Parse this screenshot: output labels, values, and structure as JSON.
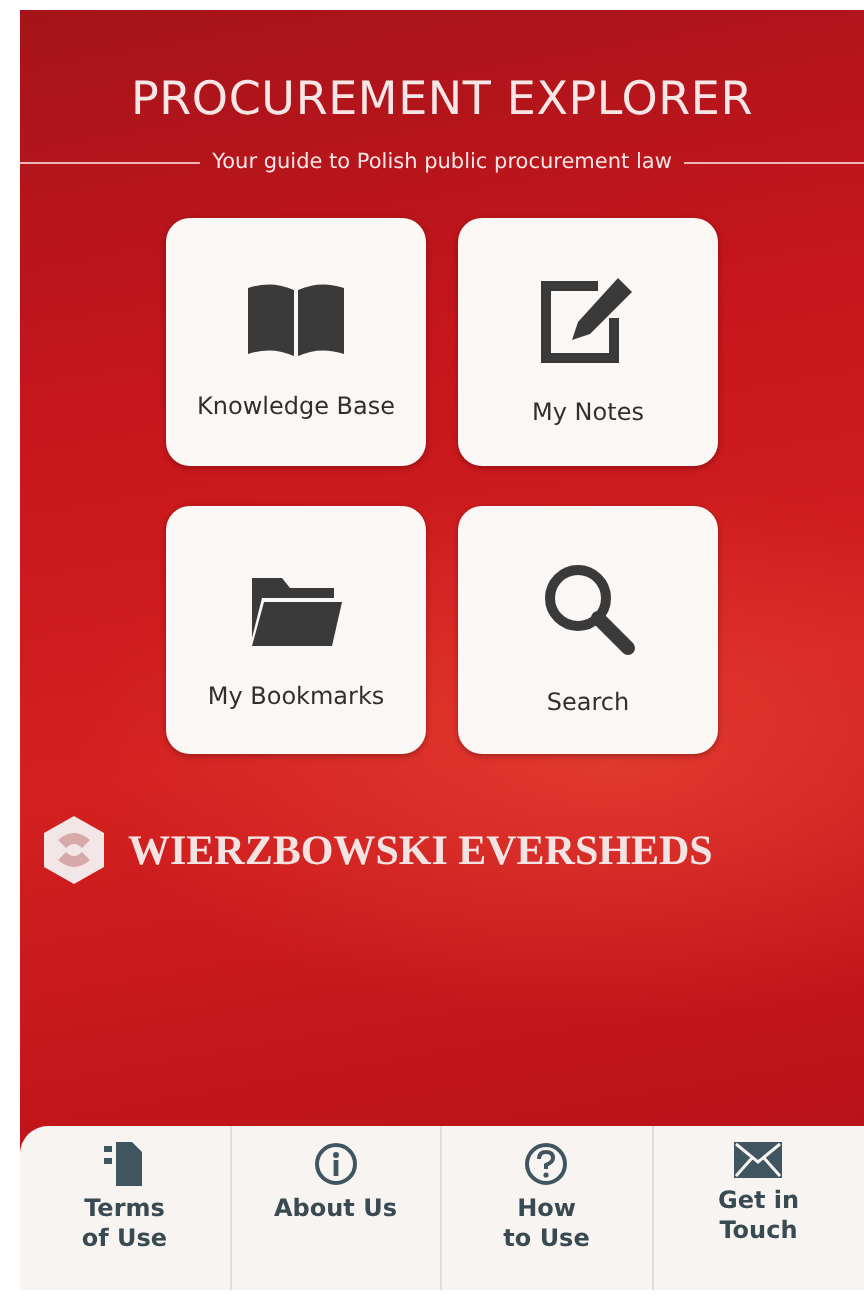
{
  "header": {
    "title": "PROCUREMENT EXPLORER",
    "subtitle": "Your guide to Polish public procurement law"
  },
  "tiles": [
    {
      "label": "Knowledge Base"
    },
    {
      "label": "My Notes"
    },
    {
      "label": "My Bookmarks"
    },
    {
      "label": "Search"
    }
  ],
  "brand": {
    "name": "WIERZBOWSKI EVERSHEDS"
  },
  "tab_bar": [
    {
      "label": "Terms\nof Use"
    },
    {
      "label": "About Us"
    },
    {
      "label": "How\nto Use"
    },
    {
      "label": "Get in\nTouch"
    }
  ]
}
